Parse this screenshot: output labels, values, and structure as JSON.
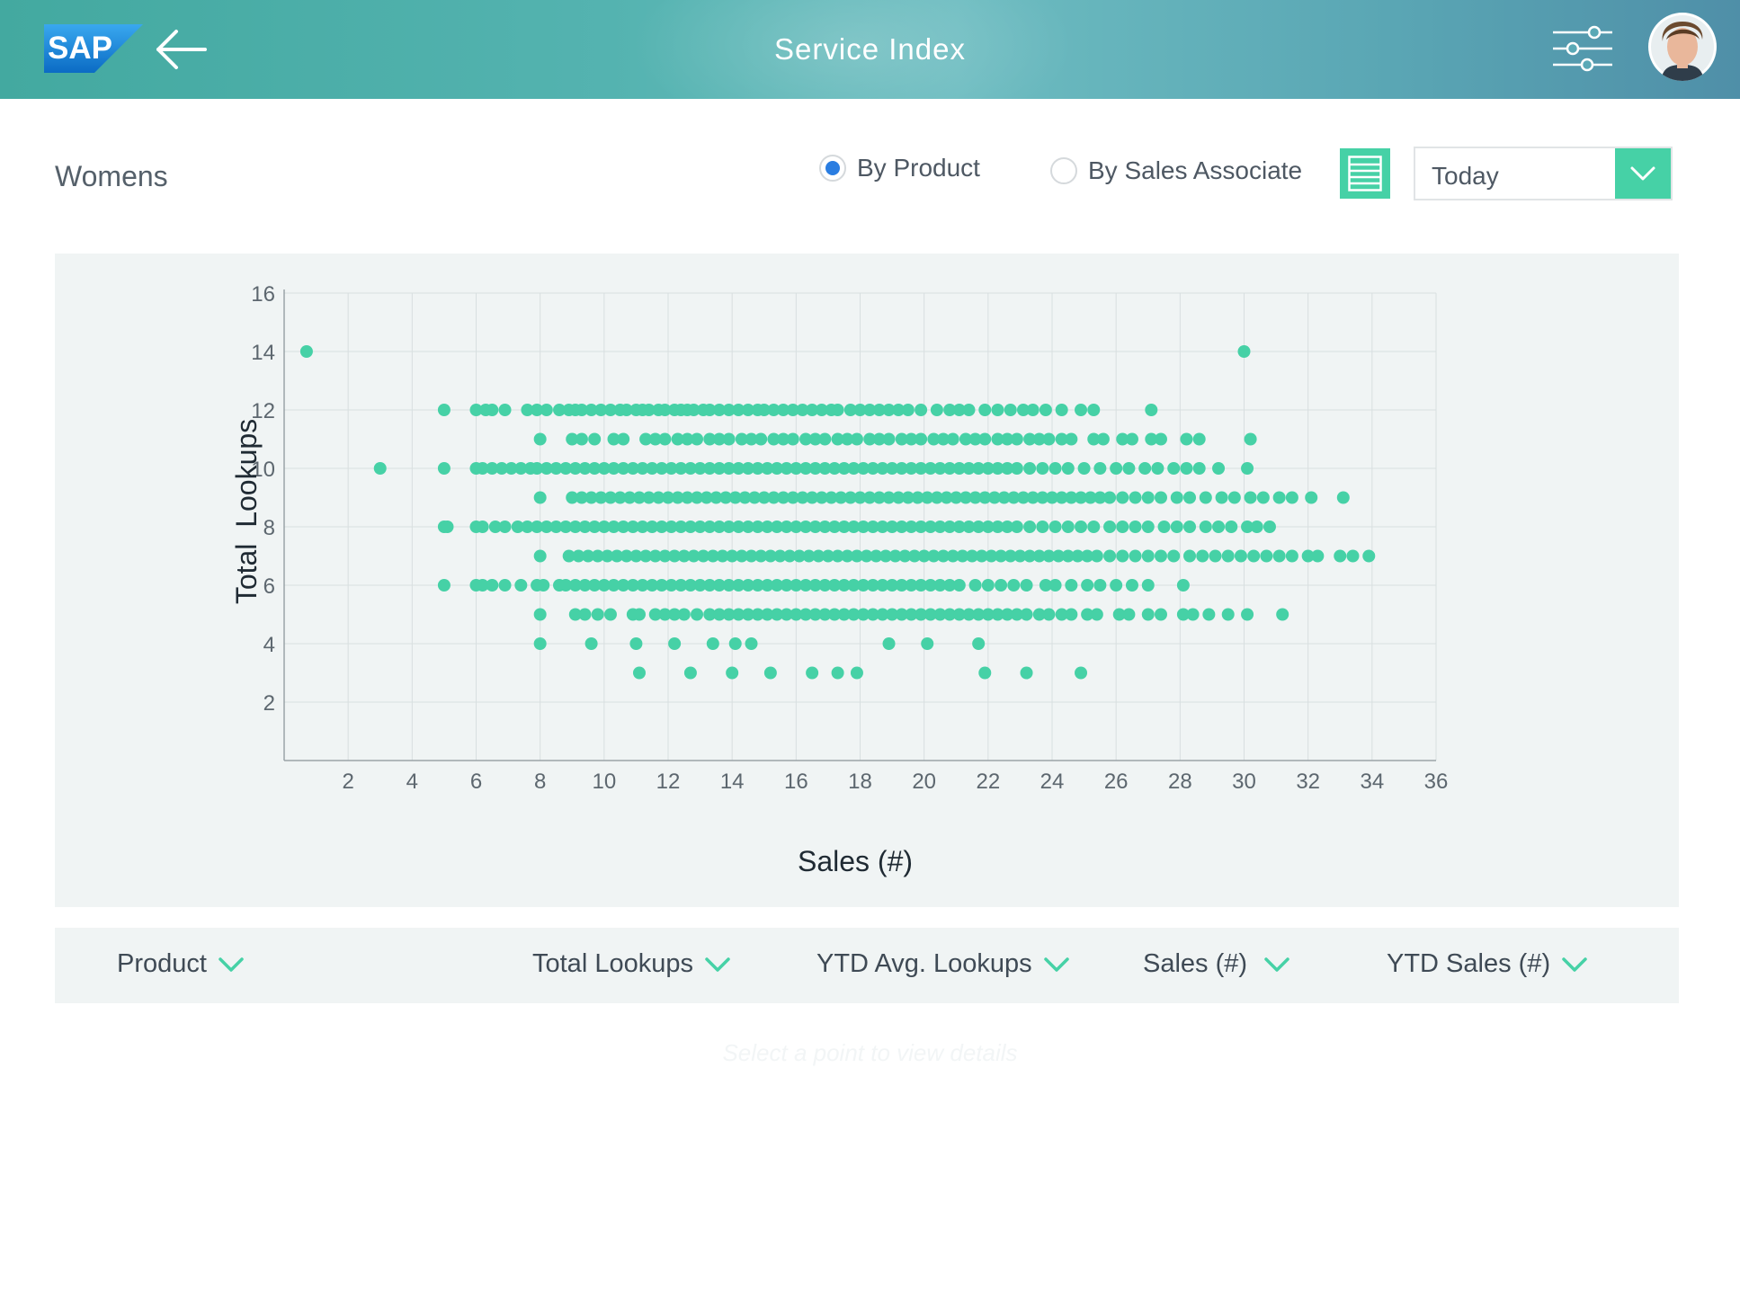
{
  "header": {
    "logo_text": "SAP",
    "title": "Service Index",
    "back_icon": "arrow-left-icon",
    "filter_icon": "sliders-icon",
    "avatar_icon": "user-avatar"
  },
  "toolbar": {
    "category": "Womens",
    "view_options": [
      {
        "label": "By Product",
        "selected": true
      },
      {
        "label": "By Sales Associate",
        "selected": false
      }
    ],
    "list_view_icon": "list-view-icon",
    "period": {
      "value": "Today",
      "icon": "chevron-down-icon"
    }
  },
  "colors": {
    "accent": "#46d1a6",
    "radio_selected": "#2a7de1",
    "panel_bg": "#f0f4f4"
  },
  "chart_data": {
    "type": "scatter",
    "title": "",
    "xlabel": "Sales (#)",
    "ylabel": "Total  Lookups",
    "xlim": [
      0,
      36
    ],
    "ylim": [
      0,
      16
    ],
    "x_ticks": [
      2,
      4,
      6,
      8,
      10,
      12,
      14,
      16,
      18,
      20,
      22,
      24,
      26,
      28,
      30,
      32,
      34,
      36
    ],
    "y_ticks": [
      2,
      4,
      6,
      8,
      10,
      12,
      14,
      16
    ],
    "grid": true,
    "series": [
      {
        "color": "#46d1a6",
        "rows": [
          {
            "y": 14,
            "x": [
              0.7,
              30
            ]
          },
          {
            "y": 12,
            "x": [
              5,
              6,
              6.3,
              6.5,
              6.9,
              7.6,
              7.9,
              8.2,
              8.6,
              8.9,
              9.1,
              9.3,
              9.6,
              9.9,
              10.2,
              10.5,
              10.7,
              11,
              11.2,
              11.4,
              11.7,
              11.9,
              12.2,
              12.4,
              12.6,
              12.8,
              13.1,
              13.3,
              13.6,
              13.9,
              14.2,
              14.5,
              14.8,
              15.0,
              15.3,
              15.6,
              15.9,
              16.2,
              16.5,
              16.8,
              17.1,
              17.3,
              17.7,
              18.0,
              18.3,
              18.6,
              18.9,
              19.2,
              19.5,
              19.9,
              20.4,
              20.8,
              21.1,
              21.4,
              21.9,
              22.3,
              22.7,
              23.1,
              23.4,
              23.8,
              24.3,
              24.9,
              25.3,
              27.1
            ]
          },
          {
            "y": 11,
            "x": [
              8,
              9,
              9.3,
              9.7,
              10.3,
              10.6,
              11.3,
              11.6,
              11.9,
              12.3,
              12.6,
              12.9,
              13.3,
              13.6,
              13.9,
              14.3,
              14.6,
              14.9,
              15.3,
              15.6,
              15.9,
              16.3,
              16.6,
              16.9,
              17.3,
              17.6,
              17.9,
              18.3,
              18.6,
              18.9,
              19.3,
              19.6,
              19.9,
              20.3,
              20.6,
              20.9,
              21.3,
              21.6,
              21.9,
              22.3,
              22.6,
              22.9,
              23.3,
              23.6,
              23.9,
              24.3,
              24.6,
              25.3,
              25.6,
              26.2,
              26.5,
              27.1,
              27.4,
              28.2,
              28.6,
              30.2
            ]
          },
          {
            "y": 10,
            "x": [
              3,
              5,
              6,
              6.2,
              6.5,
              6.8,
              7.1,
              7.4,
              7.7,
              7.9,
              8.2,
              8.5,
              8.8,
              9.1,
              9.4,
              9.7,
              10.0,
              10.3,
              10.6,
              10.9,
              11.2,
              11.5,
              11.8,
              12.1,
              12.4,
              12.7,
              13.0,
              13.3,
              13.6,
              13.9,
              14.2,
              14.5,
              14.8,
              15.1,
              15.4,
              15.7,
              16.0,
              16.3,
              16.6,
              16.9,
              17.2,
              17.5,
              17.8,
              18.1,
              18.4,
              18.7,
              19.0,
              19.3,
              19.6,
              19.9,
              20.2,
              20.5,
              20.8,
              21.1,
              21.4,
              21.7,
              22.0,
              22.3,
              22.6,
              22.9,
              23.3,
              23.7,
              24.1,
              24.5,
              25.0,
              25.5,
              26.0,
              26.4,
              26.9,
              27.3,
              27.8,
              28.2,
              28.6,
              29.2,
              30.1
            ]
          },
          {
            "y": 9,
            "x": [
              8,
              9,
              9.3,
              9.6,
              9.9,
              10.2,
              10.5,
              10.8,
              11.1,
              11.4,
              11.7,
              12.0,
              12.3,
              12.6,
              12.9,
              13.2,
              13.5,
              13.8,
              14.1,
              14.4,
              14.7,
              15.0,
              15.3,
              15.6,
              15.9,
              16.2,
              16.5,
              16.8,
              17.1,
              17.4,
              17.7,
              18.0,
              18.3,
              18.6,
              18.9,
              19.2,
              19.5,
              19.8,
              20.1,
              20.4,
              20.7,
              21.0,
              21.3,
              21.6,
              21.9,
              22.2,
              22.5,
              22.8,
              23.1,
              23.4,
              23.7,
              24.0,
              24.3,
              24.6,
              24.9,
              25.2,
              25.5,
              25.8,
              26.2,
              26.6,
              27.0,
              27.4,
              27.9,
              28.3,
              28.8,
              29.3,
              29.7,
              30.2,
              30.6,
              31.1,
              31.5,
              32.1,
              33.1
            ]
          },
          {
            "y": 8,
            "x": [
              5,
              5.1,
              6,
              6.2,
              6.6,
              6.9,
              7.3,
              7.6,
              7.9,
              8.2,
              8.5,
              8.8,
              9.1,
              9.4,
              9.7,
              10.0,
              10.3,
              10.6,
              10.9,
              11.2,
              11.5,
              11.8,
              12.1,
              12.4,
              12.7,
              13.0,
              13.3,
              13.6,
              13.9,
              14.2,
              14.5,
              14.8,
              15.1,
              15.4,
              15.7,
              16.0,
              16.3,
              16.6,
              16.9,
              17.2,
              17.5,
              17.8,
              18.1,
              18.4,
              18.7,
              19.0,
              19.3,
              19.6,
              19.9,
              20.2,
              20.5,
              20.8,
              21.1,
              21.4,
              21.7,
              22.0,
              22.3,
              22.6,
              22.9,
              23.3,
              23.7,
              24.1,
              24.5,
              24.9,
              25.3,
              25.8,
              26.2,
              26.6,
              27.0,
              27.5,
              27.9,
              28.3,
              28.8,
              29.2,
              29.6,
              30.1,
              30.4,
              30.8
            ]
          },
          {
            "y": 7,
            "x": [
              8,
              8.9,
              9.2,
              9.5,
              9.8,
              10.1,
              10.4,
              10.7,
              11.0,
              11.3,
              11.6,
              11.9,
              12.2,
              12.5,
              12.8,
              13.1,
              13.4,
              13.7,
              14.0,
              14.3,
              14.6,
              14.9,
              15.2,
              15.5,
              15.8,
              16.1,
              16.4,
              16.7,
              17.0,
              17.3,
              17.6,
              17.9,
              18.2,
              18.5,
              18.8,
              19.1,
              19.4,
              19.7,
              20.0,
              20.3,
              20.6,
              20.9,
              21.2,
              21.5,
              21.8,
              22.1,
              22.4,
              22.7,
              23.0,
              23.3,
              23.6,
              23.9,
              24.2,
              24.5,
              24.8,
              25.1,
              25.4,
              25.8,
              26.2,
              26.6,
              27.0,
              27.4,
              27.8,
              28.3,
              28.7,
              29.1,
              29.5,
              29.9,
              30.3,
              30.7,
              31.1,
              31.5,
              32.0,
              32.3,
              33.0,
              33.4,
              33.9
            ]
          },
          {
            "y": 6,
            "x": [
              5,
              6,
              6.2,
              6.5,
              6.9,
              7.4,
              7.9,
              8.1,
              8.6,
              8.8,
              9.1,
              9.4,
              9.7,
              10.0,
              10.3,
              10.6,
              10.9,
              11.2,
              11.5,
              11.8,
              12.1,
              12.4,
              12.7,
              13.0,
              13.3,
              13.6,
              13.9,
              14.2,
              14.5,
              14.8,
              15.1,
              15.4,
              15.7,
              16.0,
              16.3,
              16.6,
              16.9,
              17.2,
              17.5,
              17.8,
              18.1,
              18.4,
              18.7,
              19.0,
              19.3,
              19.6,
              19.9,
              20.2,
              20.5,
              20.8,
              21.1,
              21.6,
              22.0,
              22.4,
              22.8,
              23.2,
              23.8,
              24.1,
              24.6,
              25.1,
              25.5,
              26.0,
              26.5,
              27.0,
              28.1
            ]
          },
          {
            "y": 5,
            "x": [
              8,
              9.1,
              9.4,
              9.8,
              10.2,
              10.9,
              11.1,
              11.6,
              11.9,
              12.2,
              12.5,
              12.9,
              13.3,
              13.6,
              13.9,
              14.2,
              14.5,
              14.8,
              15.1,
              15.4,
              15.7,
              16.0,
              16.3,
              16.6,
              16.9,
              17.2,
              17.5,
              17.8,
              18.1,
              18.4,
              18.7,
              19.0,
              19.3,
              19.6,
              19.9,
              20.2,
              20.5,
              20.8,
              21.1,
              21.4,
              21.7,
              22.0,
              22.3,
              22.6,
              22.9,
              23.2,
              23.6,
              23.9,
              24.3,
              24.6,
              25.1,
              25.4,
              26.1,
              26.4,
              27.0,
              27.4,
              28.1,
              28.4,
              28.9,
              29.5,
              30.1,
              31.2
            ]
          },
          {
            "y": 4,
            "x": [
              8,
              9.6,
              11,
              12.2,
              13.4,
              14.1,
              14.6,
              18.9,
              20.1,
              21.7
            ]
          },
          {
            "y": 3,
            "x": [
              11.1,
              12.7,
              14,
              15.2,
              16.5,
              17.3,
              17.9,
              21.9,
              23.2,
              24.9
            ]
          }
        ]
      }
    ]
  },
  "table": {
    "columns": [
      {
        "label": "Product",
        "icon": "chevron-down-icon"
      },
      {
        "label": "Total Lookups",
        "icon": "chevron-down-icon"
      },
      {
        "label": "YTD Avg. Lookups",
        "icon": "chevron-down-icon"
      },
      {
        "label": "Sales (#)",
        "icon": "chevron-down-icon"
      },
      {
        "label": "YTD Sales (#)",
        "icon": "chevron-down-icon"
      }
    ],
    "empty_hint": "Select a point to view details"
  }
}
